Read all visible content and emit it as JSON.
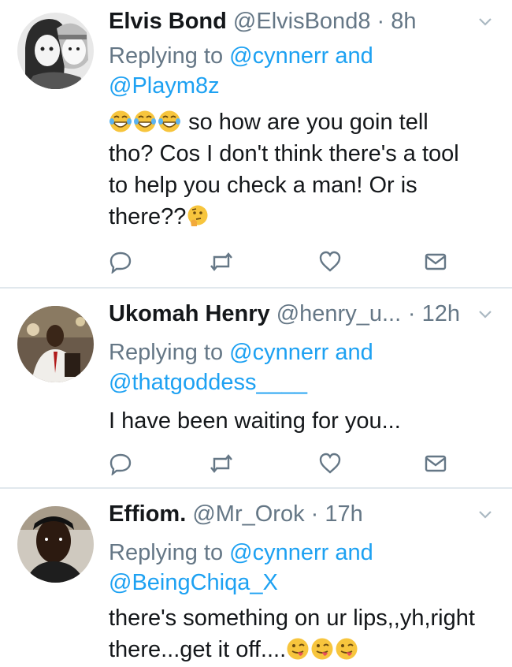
{
  "icons": {
    "reply": "reply-icon",
    "retweet": "retweet-icon",
    "like": "heart-icon",
    "message": "envelope-icon",
    "caret": "chevron-down-icon"
  },
  "colors": {
    "link": "#1da1f2",
    "muted": "#657786",
    "text": "#14171a",
    "divider": "#e1e8ed"
  },
  "tweets": [
    {
      "name": "Elvis Bond",
      "handle": "@ElvisBond8",
      "sep": "·",
      "time": "8h",
      "reply_prefix": "Replying to",
      "reply_to_1": "@cynnerr and",
      "reply_to_2": "@Playm8z",
      "text_lines": [
        "so how are you goin tell",
        "tho? Cos I don't think there's a tool",
        "to help you check a man! Or is",
        "there??"
      ],
      "emojis": [
        "tears-of-joy-emoji",
        "thinking-face-emoji"
      ]
    },
    {
      "name": "Ukomah Henry",
      "handle": "@henry_u...",
      "sep": "·",
      "time": "12h",
      "reply_prefix": "Replying to",
      "reply_to_1": "@cynnerr and",
      "reply_to_2": "@thatgoddess____",
      "text_lines": [
        "I have been waiting for you..."
      ]
    },
    {
      "name": "Effiom.",
      "handle": "@Mr_Orok",
      "sep": "·",
      "time": "17h",
      "reply_prefix": "Replying to",
      "reply_to_1": "@cynnerr and",
      "reply_to_2": "@BeingChiqa_X",
      "text_lines": [
        "there's something on ur lips,,yh,right",
        "there...get it off...."
      ],
      "emojis": [
        "winking-tongue-emoji"
      ]
    }
  ]
}
